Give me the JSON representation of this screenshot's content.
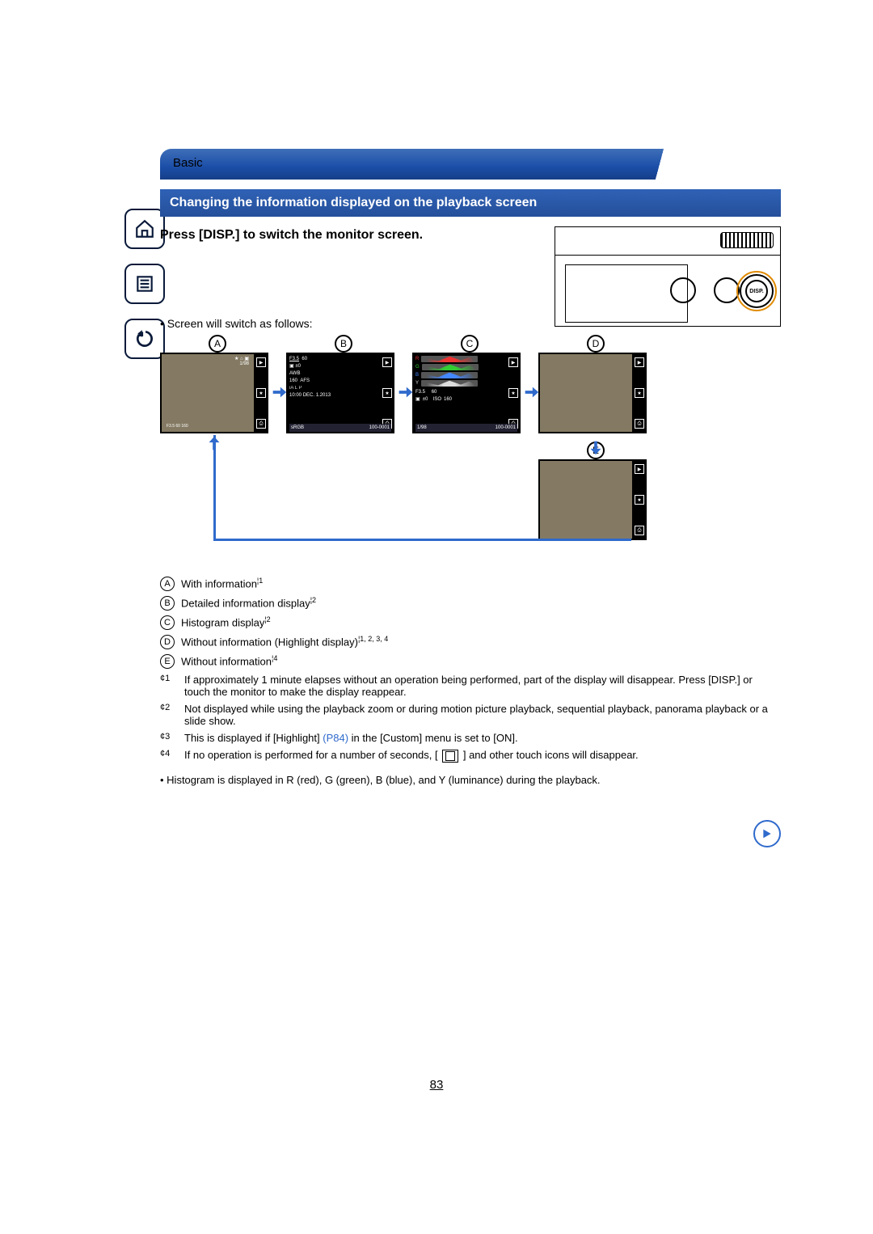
{
  "breadcrumb": "Basic",
  "section_title": "Changing the information displayed on the playback screen",
  "press_line": "Press [DISP.] to switch the monitor screen.",
  "disp_button_label": "DISP.",
  "lead_bullet": "• Screen will switch as follows:",
  "labels": {
    "A": "A",
    "B": "B",
    "C": "C",
    "D": "D",
    "E": "E"
  },
  "lcd_a": {
    "counter": "1/98",
    "aperture": "F3.5",
    "shutter": "60",
    "iso": "160"
  },
  "lcd_b": {
    "aperture": "F3.5",
    "shutter": "60",
    "ev": "±0",
    "wb": "AWB",
    "iso": "160",
    "af": "AFS",
    "row3": "iA  L  P",
    "time": "10:00",
    "date": "DEC. 1.2013",
    "file": "100-0001",
    "cs": "sRGB"
  },
  "lcd_c": {
    "r": "R",
    "g": "G",
    "b": "B",
    "y": "Y",
    "aperture": "F3.5",
    "shutter": "60",
    "ev": "±0",
    "iso": "160",
    "counter": "1/98",
    "file": "100-0001"
  },
  "legend": {
    "A": {
      "text": "With information",
      "fn": "¦1"
    },
    "B": {
      "text": "Detailed information display",
      "fn": "¦2"
    },
    "C": {
      "text": "Histogram display",
      "fn": "¦2"
    },
    "D": {
      "text": "Without information (Highlight display)",
      "fn": "¦1, 2, 3, 4"
    },
    "E": {
      "text": "Without information",
      "fn": "¦4"
    }
  },
  "notes": {
    "n1": "If approximately 1 minute elapses without an operation being performed, part of the display will disappear. Press [DISP.] or touch the monitor to make the display reappear.",
    "n2": "Not displayed while using the playback zoom or during motion picture playback, sequential playback, panorama playback or a slide show.",
    "n3_a": "This is displayed if [Highlight] ",
    "n3_link": "(P84)",
    "n3_b": " in the [Custom] menu is set to [ON].",
    "n4_a": "If no operation is performed for a number of seconds, [ ",
    "n4_b": " ] and other touch icons will disappear."
  },
  "hist_note": "• Histogram is displayed in R (red), G (green), B (blue), and Y (luminance) during the playback.",
  "page_number": "83",
  "note_prefix": {
    "n1": "¢1",
    "n2": "¢2",
    "n3": "¢3",
    "n4": "¢4"
  }
}
